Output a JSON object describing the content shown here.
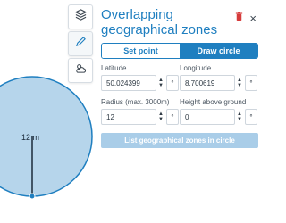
{
  "panel": {
    "title": "Overlapping geographical zones",
    "tools": [
      {
        "icon": "layers-icon"
      },
      {
        "icon": "pencil-icon"
      },
      {
        "icon": "weather-icon"
      }
    ],
    "tabs": [
      {
        "label": "Set point",
        "active": false
      },
      {
        "label": "Draw circle",
        "active": true
      }
    ],
    "fields": {
      "latitude": {
        "label": "Latitude",
        "value": "50.024399",
        "unit": "°"
      },
      "longitude": {
        "label": "Longitude",
        "value": "8.700619",
        "unit": "°"
      },
      "radius": {
        "label": "Radius (max. 3000m)",
        "value": "12",
        "unit": "°"
      },
      "height": {
        "label": "Height above ground",
        "value": "0",
        "unit": "°"
      }
    },
    "action_button": "List geographical zones in circle"
  },
  "map": {
    "radius_label": "12 m"
  },
  "colors": {
    "accent": "#1f7fc0",
    "circle_fill": "#b6d5eb",
    "circle_stroke": "#1f7fc0",
    "trash_red": "#d63b3b"
  }
}
